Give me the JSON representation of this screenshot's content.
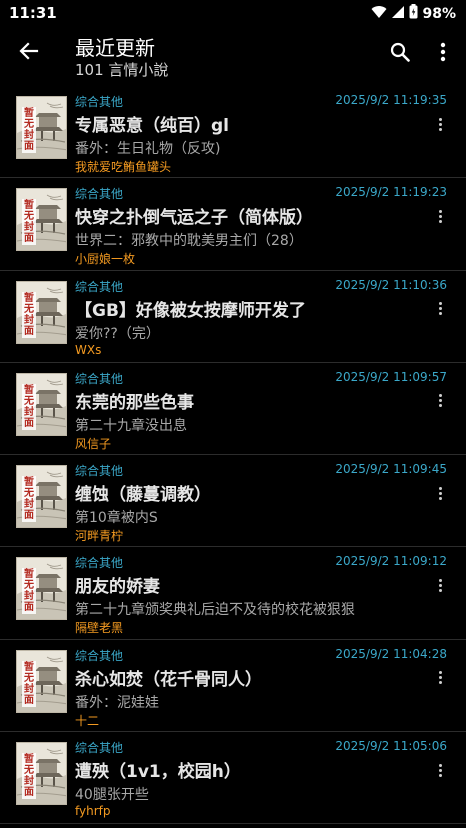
{
  "status_bar": {
    "time": "11:31",
    "battery": "98%",
    "icons": [
      "wifi-icon",
      "signal-icon",
      "battery-icon"
    ]
  },
  "appbar": {
    "title": "最近更新",
    "subtitle": "101 言情小說",
    "icons": [
      "back-arrow-icon",
      "search-icon",
      "more-vert-icon"
    ]
  },
  "cover": {
    "placeholder_text": "暂无封面",
    "colors": {
      "paper": "#e9e5da",
      "red": "#b32a20"
    }
  },
  "books": [
    {
      "category": "综合其他",
      "time": "2025/9/2 11:19:35",
      "title": "专属恶意（纯百）gl",
      "chapter": "番外：生日礼物（反攻)",
      "author": "我就爱吃鲔鱼罐头"
    },
    {
      "category": "综合其他",
      "time": "2025/9/2 11:19:23",
      "title": "快穿之扑倒气运之子（简体版）",
      "chapter": "世界二：邪教中的耽美男主们（28）",
      "author": "小厨娘一枚"
    },
    {
      "category": "综合其他",
      "time": "2025/9/2 11:10:36",
      "title": "【GB】好像被女按摩师开发了",
      "chapter": "爱你??（完）",
      "author": "WXs"
    },
    {
      "category": "综合其他",
      "time": "2025/9/2 11:09:57",
      "title": "东莞的那些色事",
      "chapter": "第二十九章没出息",
      "author": "风信子"
    },
    {
      "category": "综合其他",
      "time": "2025/9/2 11:09:45",
      "title": "缠蚀（藤蔓调教）",
      "chapter": "第10章被内S",
      "author": "河畔青柠"
    },
    {
      "category": "综合其他",
      "time": "2025/9/2 11:09:12",
      "title": "朋友的娇妻",
      "chapter": "第二十九章颁奖典礼后迫不及待的校花被狠狠",
      "author": "隔壁老黑"
    },
    {
      "category": "综合其他",
      "time": "2025/9/2 11:04:28",
      "title": "杀心如焚（花千骨同人）",
      "chapter": "番外：泥娃娃",
      "author": "十二"
    },
    {
      "category": "综合其他",
      "time": "2025/9/2 11:05:06",
      "title": "遭殃（1v1，校园h）",
      "chapter": "40腿张开些",
      "author": "fyhrfp"
    }
  ],
  "colors": {
    "background": "#000000",
    "accent_blue": "#3ba8c9",
    "author_orange": "#f39a21",
    "divider": "#2c2c2c"
  }
}
